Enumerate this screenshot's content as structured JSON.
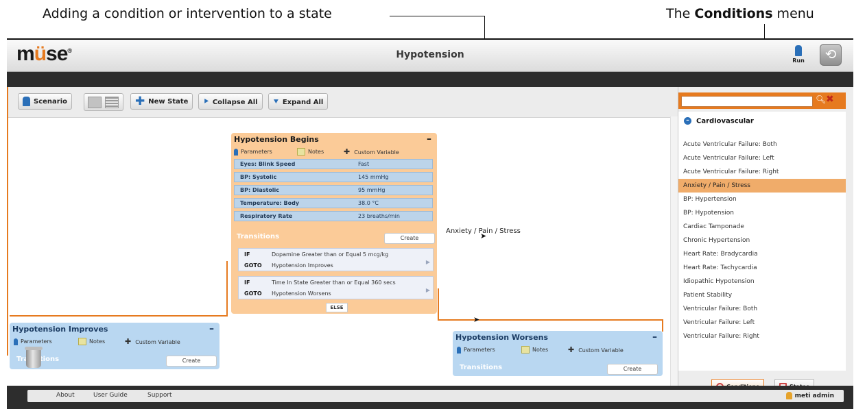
{
  "callouts": {
    "left": "Adding a condition or intervention to a state",
    "right_prefix": "The ",
    "right_bold": "Conditions",
    "right_suffix": " menu"
  },
  "app": {
    "logo_m": "m",
    "logo_u": "ü",
    "logo_se": "se",
    "logo_mark": "®",
    "title": "Hypotension",
    "run_label": "Run",
    "back_icon": "⟲"
  },
  "toolbar": {
    "scenario": "Scenario",
    "new_state": "New State",
    "collapse_all": "Collapse All",
    "expand_all": "Expand All"
  },
  "states": {
    "begins": {
      "title": "Hypotension Begins",
      "tabs": [
        "Parameters",
        "Notes",
        "Custom Variable"
      ],
      "params": [
        {
          "name": "Eyes: Blink Speed",
          "value": "Fast"
        },
        {
          "name": "BP: Systolic",
          "value": "145 mmHg"
        },
        {
          "name": "BP: Diastolic",
          "value": "95 mmHg"
        },
        {
          "name": "Temperature: Body",
          "value": "38.0 °C"
        },
        {
          "name": "Respiratory Rate",
          "value": "23 breaths/min"
        }
      ],
      "transitions_label": "Transitions",
      "create": "Create",
      "transitions": [
        {
          "if_label": "IF",
          "if": "Dopamine Greater than or Equal 5 mcg/kg",
          "goto_label": "GOTO",
          "goto": "Hypotension Improves"
        },
        {
          "if_label": "IF",
          "if": "Time In State Greater than or Equal 360 secs",
          "goto_label": "GOTO",
          "goto": "Hypotension Worsens"
        }
      ],
      "else": "ELSE"
    },
    "improves": {
      "title": "Hypotension Improves",
      "tabs": [
        "Parameters",
        "Notes",
        "Custom Variable"
      ],
      "transitions_label": "Transitions",
      "create": "Create"
    },
    "worsens": {
      "title": "Hypotension Worsens",
      "tabs": [
        "Parameters",
        "Notes",
        "Custom Variable"
      ],
      "transitions_label": "Transitions",
      "create": "Create"
    }
  },
  "drag_label": "Anxiety / Pain / Stress",
  "conditions_panel": {
    "category": "Cardiovascular",
    "items": [
      "Acute Ventricular Failure: Both",
      "Acute Ventricular Failure: Left",
      "Acute Ventricular Failure: Right",
      "Anxiety / Pain / Stress",
      "BP: Hypertension",
      "BP: Hypotension",
      "Cardiac Tamponade",
      "Chronic Hypertension",
      "Heart Rate: Bradycardia",
      "Heart Rate: Tachycardia",
      "Idiopathic Hypotension",
      "Patient Stability",
      "Ventricular Failure: Both",
      "Ventricular Failure: Left",
      "Ventricular Failure: Right"
    ],
    "selected_index": 3,
    "tab_conditions": "Conditions",
    "tab_states": "States"
  },
  "footer": {
    "links": [
      "About",
      "User Guide",
      "Support"
    ],
    "user": "meti admin"
  },
  "colors": {
    "accent": "#e67a1f",
    "state_orange": "#fbcb98",
    "state_blue": "#b9d7f1"
  }
}
